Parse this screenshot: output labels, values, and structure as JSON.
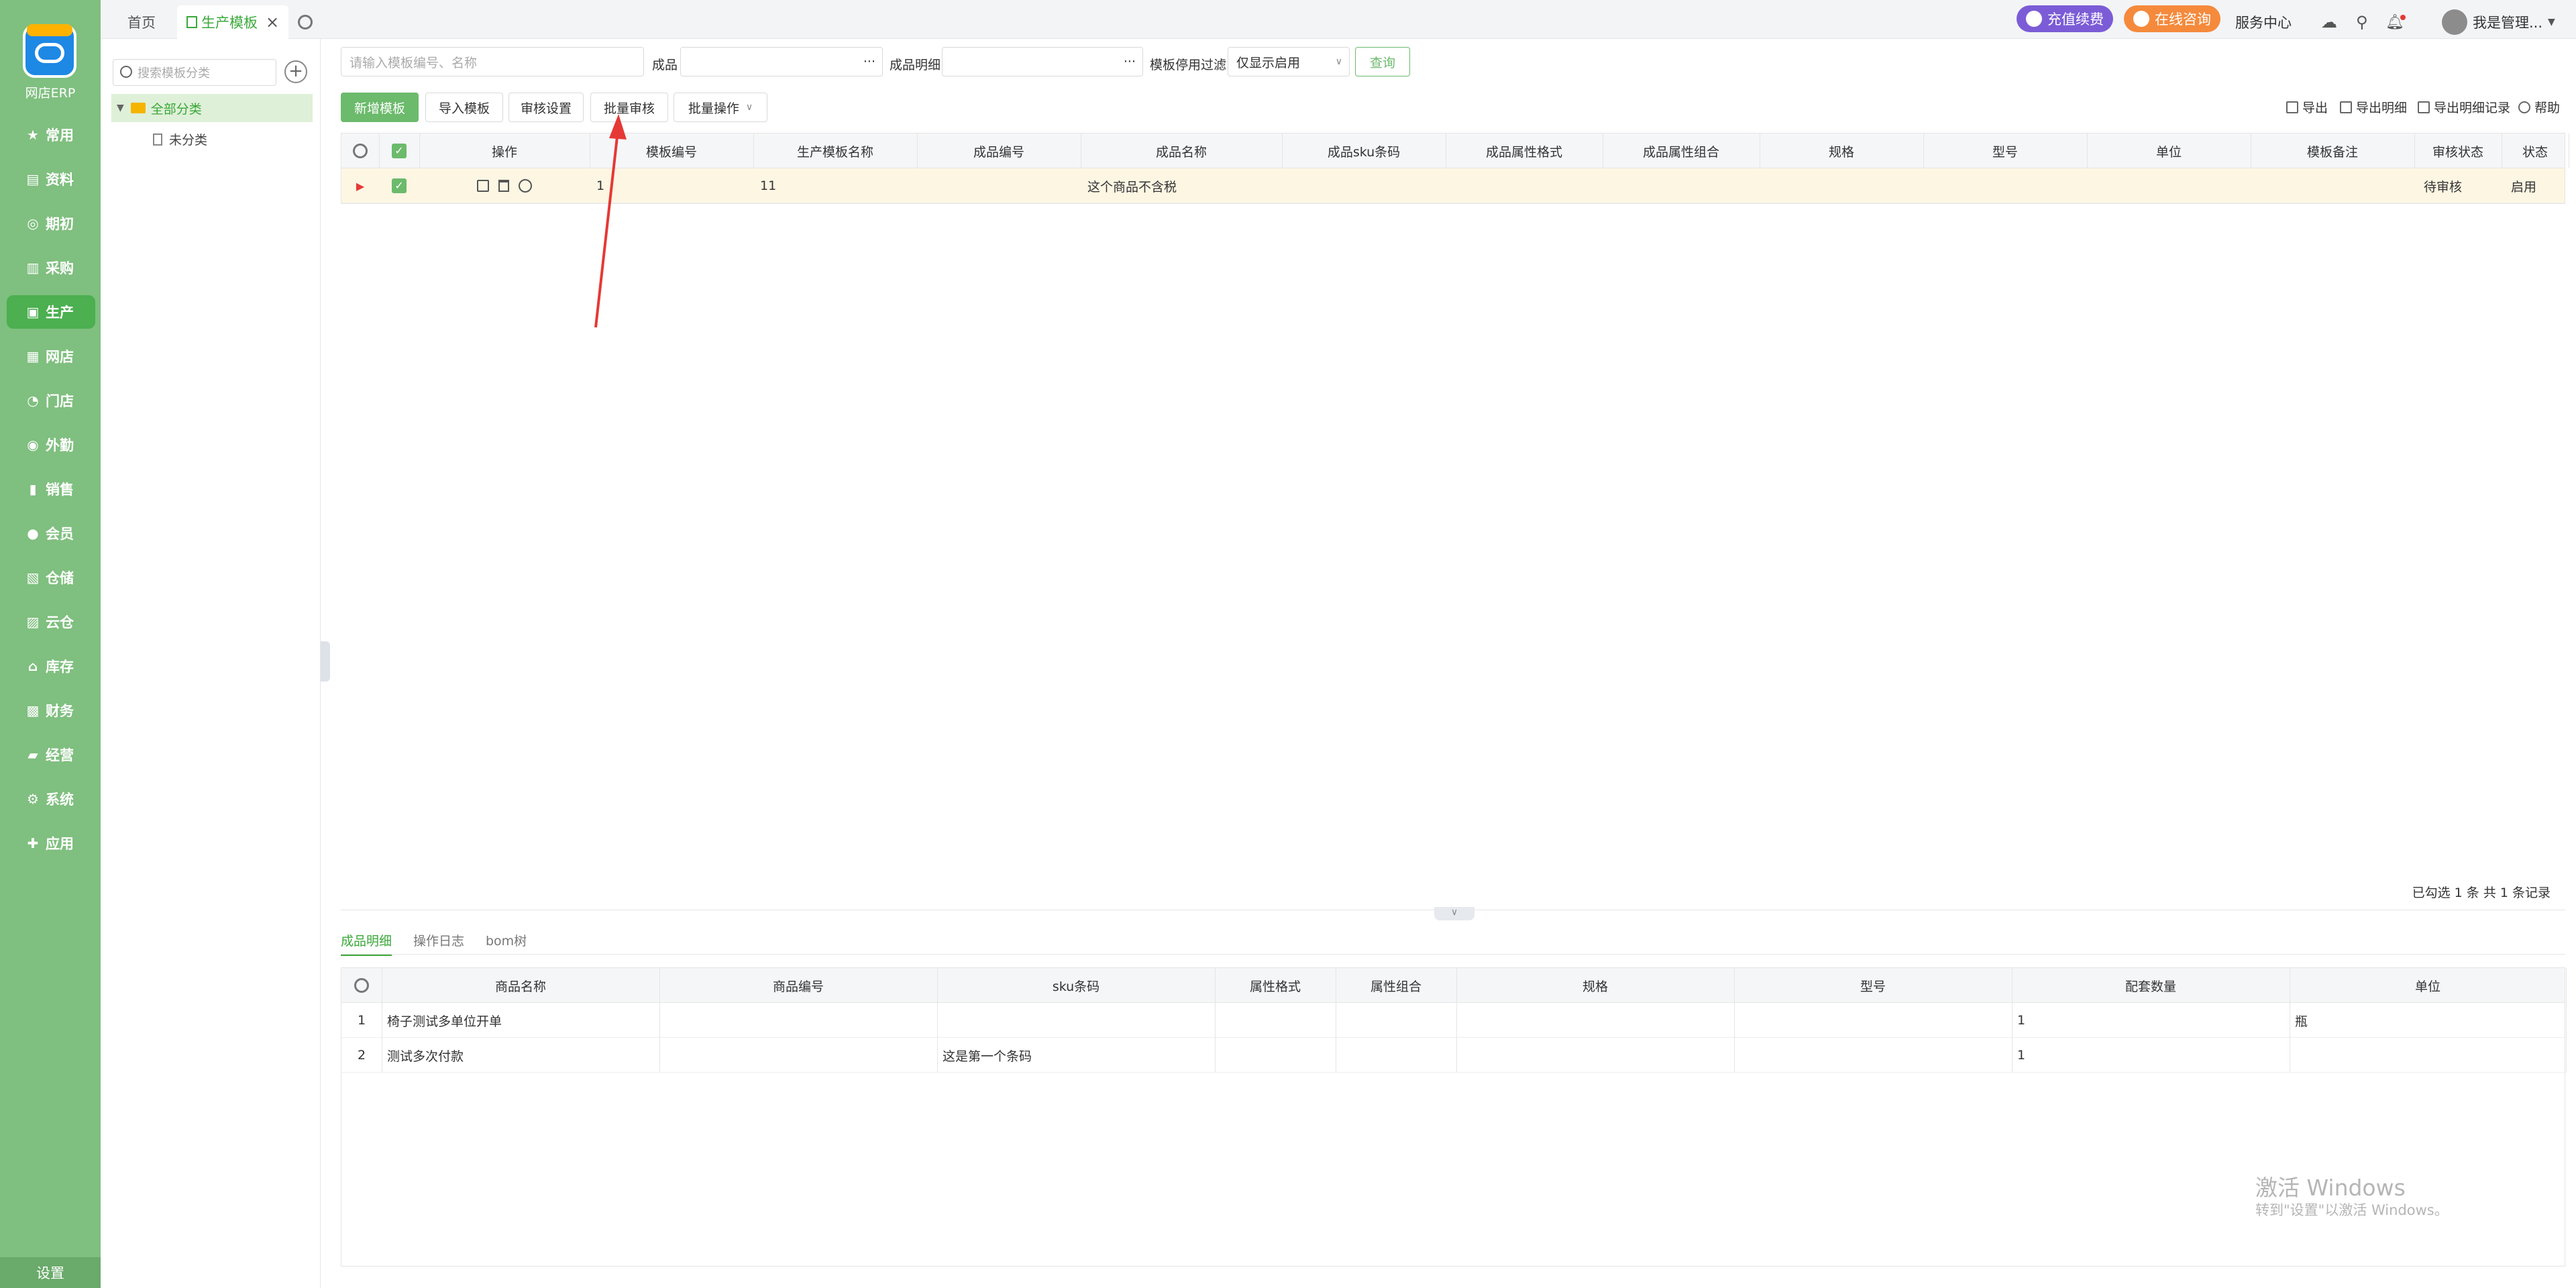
{
  "sidebar": {
    "brand": "网店ERP",
    "items": [
      {
        "icon": "★",
        "label": "常用"
      },
      {
        "icon": "▤",
        "label": "资料"
      },
      {
        "icon": "◎",
        "label": "期初"
      },
      {
        "icon": "▥",
        "label": "采购"
      },
      {
        "icon": "▣",
        "label": "生产"
      },
      {
        "icon": "▦",
        "label": "网店"
      },
      {
        "icon": "◔",
        "label": "门店"
      },
      {
        "icon": "◉",
        "label": "外勤"
      },
      {
        "icon": "▮",
        "label": "销售"
      },
      {
        "icon": "●",
        "label": "会员"
      },
      {
        "icon": "▧",
        "label": "仓储"
      },
      {
        "icon": "▨",
        "label": "云仓"
      },
      {
        "icon": "⌂",
        "label": "库存"
      },
      {
        "icon": "▩",
        "label": "财务"
      },
      {
        "icon": "▰",
        "label": "经营"
      },
      {
        "icon": "⚙",
        "label": "系统"
      },
      {
        "icon": "✚",
        "label": "应用"
      }
    ],
    "active_index": 4,
    "settings_label": "设置"
  },
  "tabbar": {
    "home_label": "首页",
    "active_tab_label": "生产模板",
    "close_icon": "×",
    "recharge_label": "充值续费",
    "consult_label": "在线咨询",
    "service_center_label": "服务中心",
    "user_label": "我是管理..."
  },
  "tree": {
    "search_placeholder": "搜索模板分类",
    "root_label": "全部分类",
    "child_label": "未分类"
  },
  "filters": {
    "keyword_placeholder": "请输入模板编号、名称",
    "product_label": "成品",
    "product_detail_label": "成品明细",
    "disable_filter_label": "模板停用过滤",
    "disable_filter_value": "仅显示启用",
    "query_label": "查询",
    "ellipsis": "···"
  },
  "toolbar": {
    "new_template": "新增模板",
    "import_template": "导入模板",
    "audit_settings": "审核设置",
    "batch_audit": "批量审核",
    "batch_ops": "批量操作",
    "export": "导出",
    "export_detail": "导出明细",
    "export_detail_log": "导出明细记录",
    "help": "帮助"
  },
  "grid": {
    "headers": [
      "操作",
      "模板编号",
      "生产模板名称",
      "成品编号",
      "成品名称",
      "成品sku条码",
      "成品属性格式",
      "成品属性组合",
      "规格",
      "型号",
      "单位",
      "模板备注",
      "审核状态",
      "状态"
    ],
    "rows": [
      {
        "code": "1",
        "name": "11",
        "product_code": "",
        "product_name": "这个商品不含税",
        "sku": "",
        "attr_format": "",
        "attr_combo": "",
        "spec": "",
        "model": "",
        "unit": "",
        "remark": "",
        "audit_status": "待审核",
        "status": "启用"
      }
    ],
    "summary": "已勾选 1 条 共 1 条记录"
  },
  "bottom_tabs": [
    "成品明细",
    "操作日志",
    "bom树"
  ],
  "detail": {
    "headers": [
      "商品名称",
      "商品编号",
      "sku条码",
      "属性格式",
      "属性组合",
      "规格",
      "型号",
      "配套数量",
      "单位"
    ],
    "rows": [
      {
        "idx": "1",
        "name": "椅子测试多单位开单",
        "code": "",
        "sku": "",
        "attr_format": "",
        "attr_combo": "",
        "spec": "",
        "model": "",
        "qty": "1",
        "unit": "瓶"
      },
      {
        "idx": "2",
        "name": "测试多次付款",
        "code": "",
        "sku": "这是第一个条码",
        "attr_format": "",
        "attr_combo": "",
        "spec": "",
        "model": "",
        "qty": "1",
        "unit": ""
      }
    ]
  },
  "watermark": {
    "line1": "激活 Windows",
    "line2": "转到\"设置\"以激活 Windows。"
  },
  "colors": {
    "sidebar": "#7fbf7f",
    "accent": "#3aa83a",
    "recharge": "#7b5cd6",
    "consult": "#f58a3c",
    "arrow": "#e53935"
  }
}
